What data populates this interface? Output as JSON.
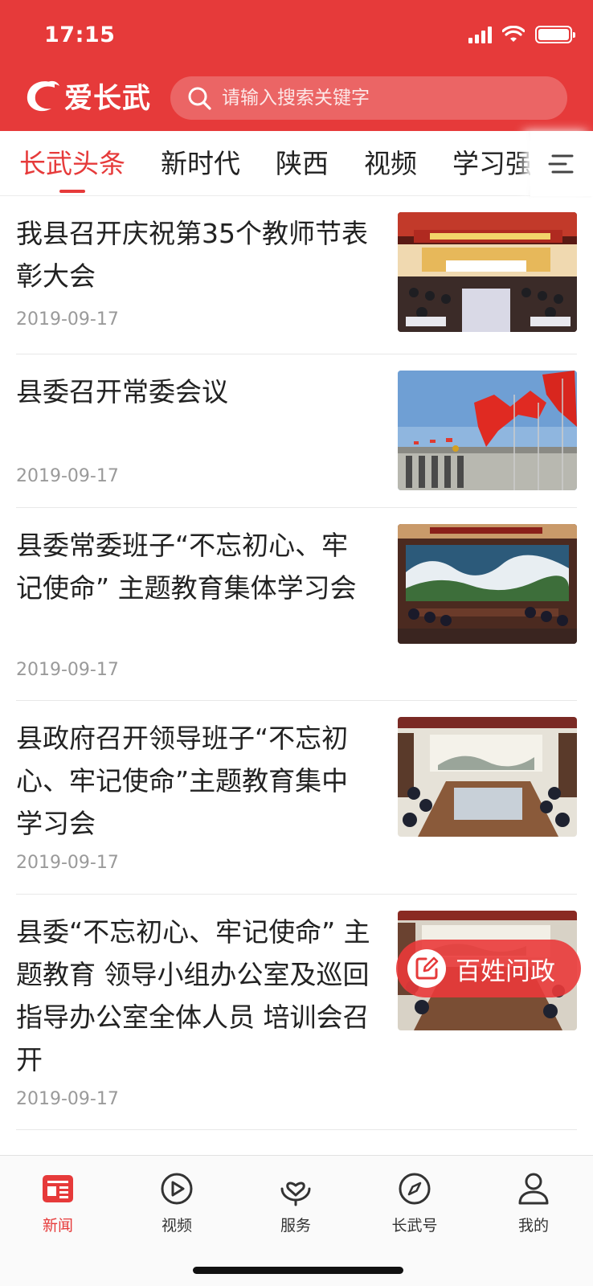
{
  "status_bar": {
    "time": "17:15"
  },
  "header": {
    "logo_text": "爱长武",
    "search_placeholder": "请输入搜索关键字"
  },
  "tabs": [
    "长武头条",
    "新时代",
    "陕西",
    "视频",
    "学习强国"
  ],
  "news": [
    {
      "title": "我县召开庆祝第35个教师节表彰大会",
      "date": "2019-09-17",
      "image": "meeting-hall-photo"
    },
    {
      "title": "县委召开常委会议",
      "date": "2019-09-17",
      "image": "red-flags-photo"
    },
    {
      "title": "县委常委班子“不忘初心、牢记使命” 主题教育集体学习会",
      "date": "2019-09-17",
      "image": "conference-room-photo"
    },
    {
      "title": "县政府召开领导班子“不忘初心、牢记使命”主题教育集中学习会",
      "date": "2019-09-17",
      "image": "meeting-table-photo"
    },
    {
      "title": "县委“不忘初心、牢记使命” 主题教育 领导小组办公室及巡回指导办公室全体人员 培训会召开",
      "date": "2019-09-17",
      "image": "training-room-photo"
    }
  ],
  "fab": {
    "label": "百姓问政",
    "icon": "edit-icon"
  },
  "bottom_nav": [
    {
      "label": "新闻",
      "icon": "news-icon",
      "active": true
    },
    {
      "label": "视频",
      "icon": "play-icon",
      "active": false
    },
    {
      "label": "服务",
      "icon": "service-icon",
      "active": false
    },
    {
      "label": "长武号",
      "icon": "compass-icon",
      "active": false
    },
    {
      "label": "我的",
      "icon": "user-icon",
      "active": false
    }
  ],
  "colors": {
    "brand": "#e63a3a",
    "date_text": "#9a9a9a"
  }
}
